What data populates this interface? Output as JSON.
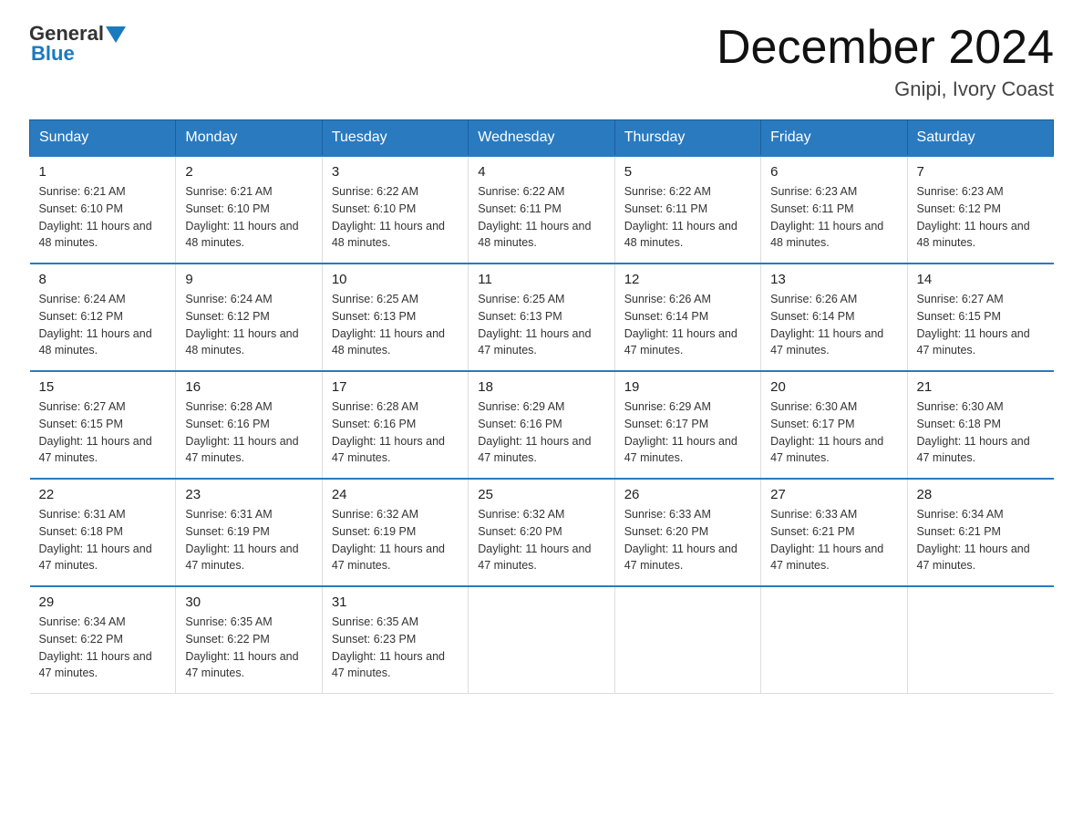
{
  "header": {
    "logo_general": "General",
    "logo_blue": "Blue",
    "title": "December 2024",
    "location": "Gnipi, Ivory Coast"
  },
  "days_of_week": [
    "Sunday",
    "Monday",
    "Tuesday",
    "Wednesday",
    "Thursday",
    "Friday",
    "Saturday"
  ],
  "weeks": [
    [
      {
        "day": "1",
        "sunrise": "6:21 AM",
        "sunset": "6:10 PM",
        "daylight": "11 hours and 48 minutes."
      },
      {
        "day": "2",
        "sunrise": "6:21 AM",
        "sunset": "6:10 PM",
        "daylight": "11 hours and 48 minutes."
      },
      {
        "day": "3",
        "sunrise": "6:22 AM",
        "sunset": "6:10 PM",
        "daylight": "11 hours and 48 minutes."
      },
      {
        "day": "4",
        "sunrise": "6:22 AM",
        "sunset": "6:11 PM",
        "daylight": "11 hours and 48 minutes."
      },
      {
        "day": "5",
        "sunrise": "6:22 AM",
        "sunset": "6:11 PM",
        "daylight": "11 hours and 48 minutes."
      },
      {
        "day": "6",
        "sunrise": "6:23 AM",
        "sunset": "6:11 PM",
        "daylight": "11 hours and 48 minutes."
      },
      {
        "day": "7",
        "sunrise": "6:23 AM",
        "sunset": "6:12 PM",
        "daylight": "11 hours and 48 minutes."
      }
    ],
    [
      {
        "day": "8",
        "sunrise": "6:24 AM",
        "sunset": "6:12 PM",
        "daylight": "11 hours and 48 minutes."
      },
      {
        "day": "9",
        "sunrise": "6:24 AM",
        "sunset": "6:12 PM",
        "daylight": "11 hours and 48 minutes."
      },
      {
        "day": "10",
        "sunrise": "6:25 AM",
        "sunset": "6:13 PM",
        "daylight": "11 hours and 48 minutes."
      },
      {
        "day": "11",
        "sunrise": "6:25 AM",
        "sunset": "6:13 PM",
        "daylight": "11 hours and 47 minutes."
      },
      {
        "day": "12",
        "sunrise": "6:26 AM",
        "sunset": "6:14 PM",
        "daylight": "11 hours and 47 minutes."
      },
      {
        "day": "13",
        "sunrise": "6:26 AM",
        "sunset": "6:14 PM",
        "daylight": "11 hours and 47 minutes."
      },
      {
        "day": "14",
        "sunrise": "6:27 AM",
        "sunset": "6:15 PM",
        "daylight": "11 hours and 47 minutes."
      }
    ],
    [
      {
        "day": "15",
        "sunrise": "6:27 AM",
        "sunset": "6:15 PM",
        "daylight": "11 hours and 47 minutes."
      },
      {
        "day": "16",
        "sunrise": "6:28 AM",
        "sunset": "6:16 PM",
        "daylight": "11 hours and 47 minutes."
      },
      {
        "day": "17",
        "sunrise": "6:28 AM",
        "sunset": "6:16 PM",
        "daylight": "11 hours and 47 minutes."
      },
      {
        "day": "18",
        "sunrise": "6:29 AM",
        "sunset": "6:16 PM",
        "daylight": "11 hours and 47 minutes."
      },
      {
        "day": "19",
        "sunrise": "6:29 AM",
        "sunset": "6:17 PM",
        "daylight": "11 hours and 47 minutes."
      },
      {
        "day": "20",
        "sunrise": "6:30 AM",
        "sunset": "6:17 PM",
        "daylight": "11 hours and 47 minutes."
      },
      {
        "day": "21",
        "sunrise": "6:30 AM",
        "sunset": "6:18 PM",
        "daylight": "11 hours and 47 minutes."
      }
    ],
    [
      {
        "day": "22",
        "sunrise": "6:31 AM",
        "sunset": "6:18 PM",
        "daylight": "11 hours and 47 minutes."
      },
      {
        "day": "23",
        "sunrise": "6:31 AM",
        "sunset": "6:19 PM",
        "daylight": "11 hours and 47 minutes."
      },
      {
        "day": "24",
        "sunrise": "6:32 AM",
        "sunset": "6:19 PM",
        "daylight": "11 hours and 47 minutes."
      },
      {
        "day": "25",
        "sunrise": "6:32 AM",
        "sunset": "6:20 PM",
        "daylight": "11 hours and 47 minutes."
      },
      {
        "day": "26",
        "sunrise": "6:33 AM",
        "sunset": "6:20 PM",
        "daylight": "11 hours and 47 minutes."
      },
      {
        "day": "27",
        "sunrise": "6:33 AM",
        "sunset": "6:21 PM",
        "daylight": "11 hours and 47 minutes."
      },
      {
        "day": "28",
        "sunrise": "6:34 AM",
        "sunset": "6:21 PM",
        "daylight": "11 hours and 47 minutes."
      }
    ],
    [
      {
        "day": "29",
        "sunrise": "6:34 AM",
        "sunset": "6:22 PM",
        "daylight": "11 hours and 47 minutes."
      },
      {
        "day": "30",
        "sunrise": "6:35 AM",
        "sunset": "6:22 PM",
        "daylight": "11 hours and 47 minutes."
      },
      {
        "day": "31",
        "sunrise": "6:35 AM",
        "sunset": "6:23 PM",
        "daylight": "11 hours and 47 minutes."
      },
      null,
      null,
      null,
      null
    ]
  ]
}
